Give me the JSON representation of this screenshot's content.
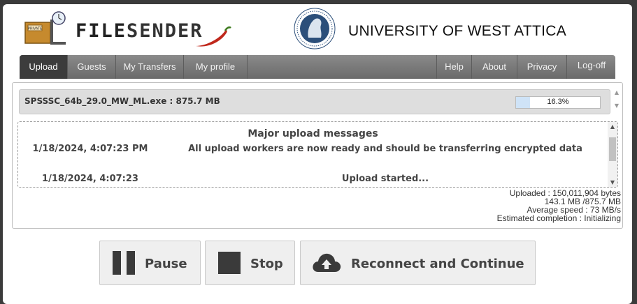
{
  "header": {
    "logo_sign": "PRIVATE",
    "logo_text_a": "FILE",
    "logo_text_b": "SENDER",
    "university": "UNIVERSITY OF WEST ATTICA"
  },
  "menu": {
    "left": [
      "Upload",
      "Guests",
      "My Transfers",
      "My profile"
    ],
    "right": [
      "Help",
      "About",
      "Privacy",
      "Log-off"
    ],
    "active": "Upload"
  },
  "upload": {
    "file_label": "SPSSSC_64b_29.0_MW_ML.exe : 875.7 MB",
    "progress_text": "16.3%",
    "progress_fraction": 0.163
  },
  "messages": {
    "title": "Major upload messages",
    "rows": [
      {
        "time": "1/18/2024, 4:07:23 PM",
        "text": "All upload workers are now ready and should be transferring encrypted data"
      },
      {
        "time": "1/18/2024, 4:07:23",
        "text": "Upload started..."
      }
    ]
  },
  "stats": {
    "uploaded": "Uploaded : 150,011,904 bytes",
    "size": "143.1 MB /875.7 MB",
    "speed": "Average speed : 73 MB/s",
    "eta": "Estimated completion : Initializing"
  },
  "buttons": {
    "pause": "Pause",
    "stop": "Stop",
    "reconnect": "Reconnect and Continue"
  },
  "colors": {
    "menubar": "#7a7a7a",
    "menu_active": "#3c3c3c",
    "progress_fill": "#cfe3f7",
    "button_bg": "#efefef"
  }
}
